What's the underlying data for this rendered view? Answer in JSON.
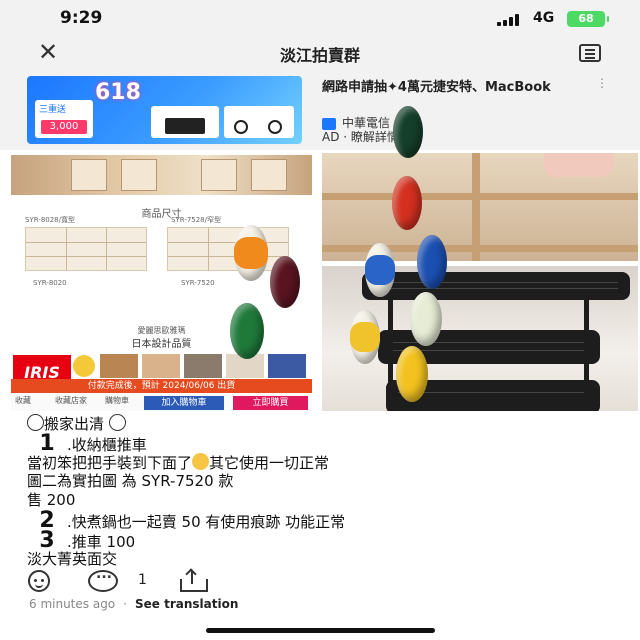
{
  "status": {
    "time": "9:29",
    "network": "4G",
    "battery": "68"
  },
  "header": {
    "title": "淡江拍賣群",
    "close_icon": "close-icon",
    "menu_icon": "menu-icon"
  },
  "ad": {
    "banner_618": "618",
    "banner_left_top": "三重送",
    "banner_left_button": "3,000",
    "title": "網路申請抽✦4萬元捷安特、MacBook",
    "source": "中華電信",
    "tag": "AD · 瞭解詳情 >",
    "more": "⋮"
  },
  "product_image": {
    "heading": "商品尺寸",
    "labels": [
      "SYR-8028/寬型",
      "SYR-7528/窄型",
      "SYR-8020",
      "SYR-7520"
    ],
    "feature_small": "愛麗思歐雅瑪",
    "feature": "日本設計品質",
    "brand": "IRIS",
    "promo": "付款完成後，預計 2024/06/06 出貨",
    "bar": {
      "fav": "收藏",
      "store": "收藏店家",
      "cart_icon_label": "購物車",
      "add_to_cart": "加入購物車",
      "buy_now": "立即購買"
    }
  },
  "post": {
    "heading": "搬家出清",
    "items": [
      {
        "num": "1",
        "text": ".收納櫃推車"
      },
      {
        "text_a": "當初笨把把手裝到下面了",
        "text_b": "其它使用一切正常"
      },
      {
        "text": "圖二為實拍圖 為 SYR-7520 款"
      },
      {
        "text": "售 200"
      },
      {
        "num": "2",
        "text": ".快煮鍋也一起賣 50 有使用痕跡 功能正常"
      },
      {
        "num": "3",
        "text": ".推車 100"
      },
      {
        "text": "淡大菁英面交"
      }
    ]
  },
  "actions": {
    "comment_count": "1"
  },
  "meta": {
    "time": "6 minutes ago",
    "separator": "·",
    "translate": "See translation"
  },
  "colors": {
    "background": "#ffffff",
    "header_bg": "#f2f2f2",
    "battery": "#4cd964",
    "brand_red": "#e60012"
  }
}
